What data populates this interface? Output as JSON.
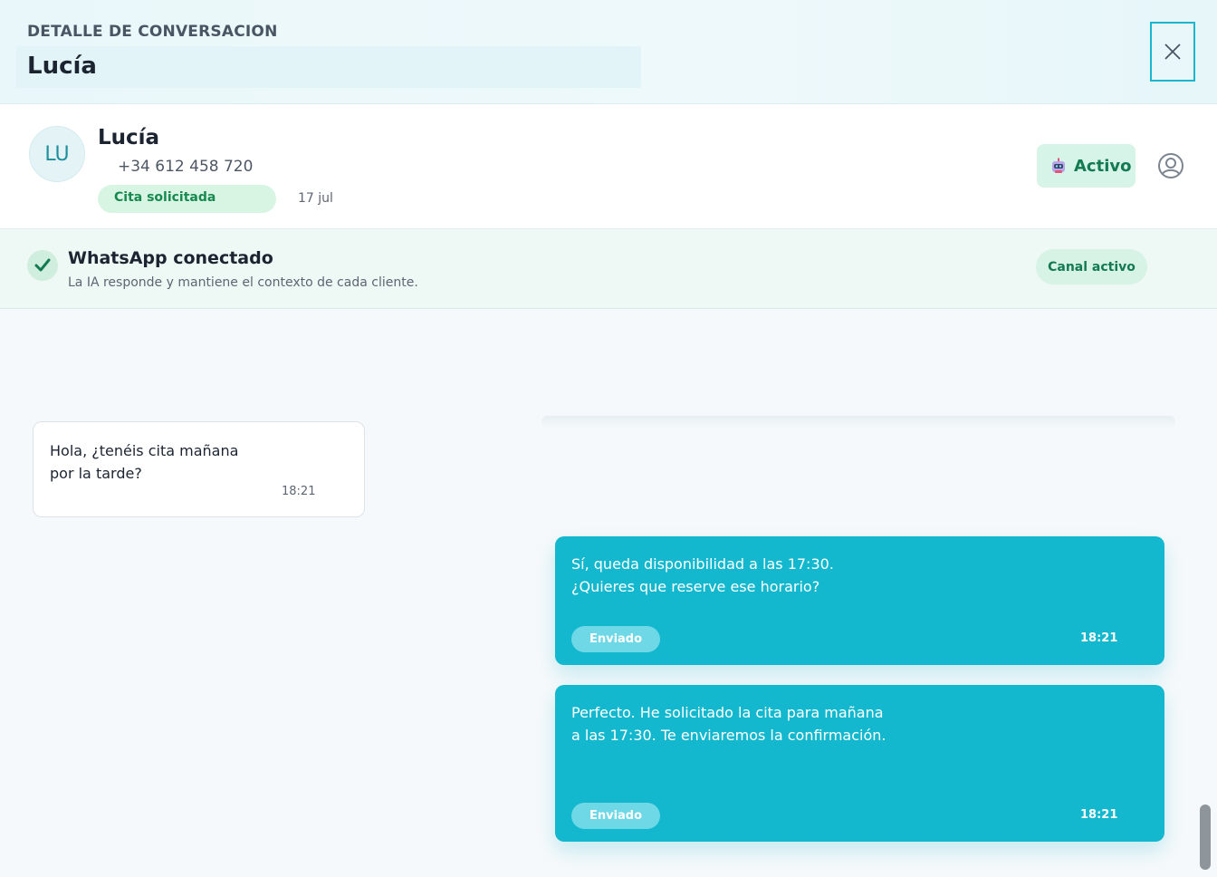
{
  "header": {
    "overline": "DETALLE DE CONVERSACION",
    "title": "Lucía",
    "close_icon": "close-icon"
  },
  "contact": {
    "initials": "LU",
    "name": "Lucía",
    "phone": "+34 612 458 720",
    "status": "Cita solicitada",
    "date": "17 jul",
    "ai_toggle": {
      "icon": "robot-icon",
      "label": "Activo"
    },
    "user_icon": "user-circle-icon"
  },
  "channel": {
    "icon": "check-icon",
    "title": "WhatsApp conectado",
    "description": "La IA responde y mantiene el contexto de cada cliente.",
    "pill": "Canal activo"
  },
  "messages": [
    {
      "direction": "incoming",
      "lines": [
        "Hola, ¿tenéis cita mañana",
        "por la tarde?"
      ],
      "time": "18:21"
    },
    {
      "direction": "outgoing",
      "lines": [
        "Sí, queda disponibilidad a las 17:30.",
        "¿Quieres que reserve ese horario?"
      ],
      "status": "Enviado",
      "time": "18:21"
    },
    {
      "direction": "outgoing",
      "lines": [
        "Perfecto. He solicitado la cita para mañana",
        "a las 17:30. Te enviaremos la confirmación."
      ],
      "status": "Enviado",
      "time": "18:21"
    }
  ],
  "colors": {
    "accent": "#13b8cf",
    "success": "#17894f",
    "success_bg": "#d8f5e4"
  }
}
